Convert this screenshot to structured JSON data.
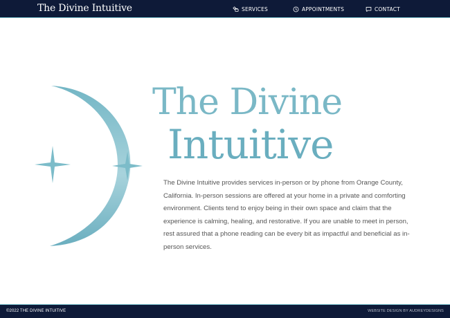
{
  "header": {
    "brand": "The Divine Intuitive",
    "nav": [
      {
        "label": "SERVICES",
        "icon": "services-icon"
      },
      {
        "label": "APPOINTMENTS",
        "icon": "clock-icon"
      },
      {
        "label": "CONTACT",
        "icon": "message-icon"
      }
    ]
  },
  "hero": {
    "title_line1": "The Divine",
    "title_line2": "Intuitive",
    "description": "The Divine Intuitive provides services in-person or by phone from Orange County, California. In-person sessions are offered at your home in a private and comforting environment. Clients tend to enjoy being in their own space and claim that the experience is calming, healing, and restorative. If you are unable to meet in person, rest assured that a phone reading can be every bit as impactful and beneficial as in-person services."
  },
  "footer": {
    "copyright": "©2022 THE DIVINE INTUITIVE",
    "credit": "WEBSITE DESIGN BY AUDREYDESIGNS"
  },
  "colors": {
    "navy": "#0e1a38",
    "accent": "#6fb7c4",
    "title": "#7ab8c6",
    "text": "#555555"
  }
}
